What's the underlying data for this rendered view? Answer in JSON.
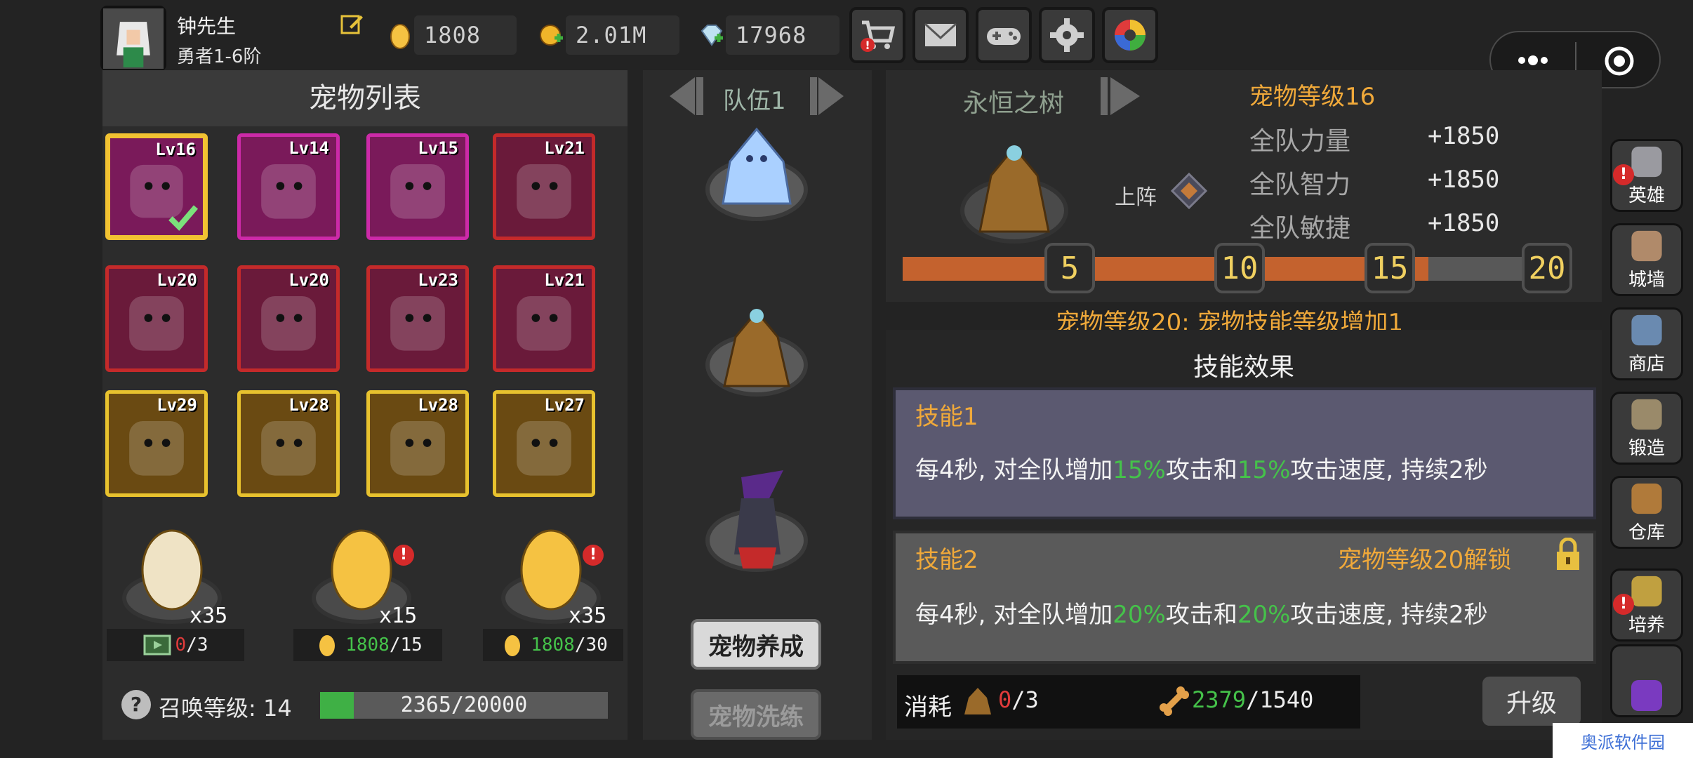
{
  "header": {
    "username": "钟先生",
    "rank": "勇者1-6阶",
    "resources": [
      {
        "icon": "egg-coin-icon",
        "value": "1808"
      },
      {
        "icon": "gold-coin-icon",
        "value": "2.01M"
      },
      {
        "icon": "diamond-icon",
        "value": "17968"
      }
    ],
    "buttons": [
      "shop-cart-icon",
      "mail-icon",
      "gamepad-icon",
      "settings-gear-icon",
      "color-wheel-icon"
    ]
  },
  "pet_list": {
    "title": "宠物列表",
    "pets": [
      {
        "level": "Lv16",
        "frame": "#f2c232",
        "bg": "#7a1a5a",
        "selected": true
      },
      {
        "level": "Lv14",
        "frame": "#cc2aa8",
        "bg": "#7a1a5a"
      },
      {
        "level": "Lv15",
        "frame": "#cc2aa8",
        "bg": "#7a1a5a"
      },
      {
        "level": "Lv21",
        "frame": "#c42a2a",
        "bg": "#6a1a3a"
      },
      {
        "level": "Lv20",
        "frame": "#c42a2a",
        "bg": "#6a1a3a"
      },
      {
        "level": "Lv20",
        "frame": "#c42a2a",
        "bg": "#6a1a3a"
      },
      {
        "level": "Lv23",
        "frame": "#c42a2a",
        "bg": "#6a1a3a"
      },
      {
        "level": "Lv21",
        "frame": "#c42a2a",
        "bg": "#6a1a3a"
      },
      {
        "level": "Lv29",
        "frame": "#e8c22e",
        "bg": "#6a4a12"
      },
      {
        "level": "Lv28",
        "frame": "#e8c22e",
        "bg": "#6a4a12"
      },
      {
        "level": "Lv28",
        "frame": "#e8c22e",
        "bg": "#6a4a12"
      },
      {
        "level": "Lv27",
        "frame": "#e8c22e",
        "bg": "#6a4a12"
      }
    ]
  },
  "eggs": [
    {
      "count": "x35",
      "cost_current": "0",
      "cost_total": "/3",
      "color": "#efe3c5"
    },
    {
      "count": "x15",
      "cost_current": "1808",
      "cost_total": "/15",
      "color": "#f5c242"
    },
    {
      "count": "x35",
      "cost_current": "1808",
      "cost_total": "/30",
      "color": "#f5c242"
    }
  ],
  "summon": {
    "label": "召唤等级: 14",
    "progress_text": "2365/20000",
    "progress": 0.118
  },
  "team": {
    "label": "队伍1",
    "train_button": "宠物养成",
    "refine_button": "宠物洗练"
  },
  "pet_detail": {
    "name": "永恒之树",
    "level_label": "宠物等级16",
    "deploy_label": "上阵",
    "stats": [
      {
        "label": "全队力量",
        "value": "+1850"
      },
      {
        "label": "全队智力",
        "value": "+1850"
      },
      {
        "label": "全队敏捷",
        "value": "+1850"
      }
    ],
    "milestones": [
      "5",
      "10",
      "15",
      "20"
    ],
    "level_progress": 0.8,
    "milestone_note": "宠物等级20: 宠物技能等级增加1"
  },
  "skills": {
    "title": "技能效果",
    "skill1": {
      "name": "技能1",
      "text_a": "每4秒, 对全队增加",
      "pct_a": "15%",
      "text_b": "攻击和",
      "pct_b": "15%",
      "text_c": "攻击速度, 持续2秒"
    },
    "skill2": {
      "name": "技能2",
      "unlock": "宠物等级20解锁",
      "text_a": "每4秒, 对全队增加",
      "pct_a": "20%",
      "text_b": "攻击和",
      "pct_b": "20%",
      "text_c": "攻击速度, 持续2秒"
    }
  },
  "cost": {
    "label": "消耗",
    "pet_current": "0",
    "pet_total": "/3",
    "bone_current": "2379",
    "bone_total": "/1540",
    "upgrade_button": "升级"
  },
  "side_nav": [
    {
      "label": "英雄",
      "icon": "helmet-icon",
      "alert": true
    },
    {
      "label": "城墙",
      "icon": "castle-wall-icon",
      "alert": false
    },
    {
      "label": "商店",
      "icon": "store-icon",
      "alert": false
    },
    {
      "label": "锻造",
      "icon": "anvil-icon",
      "alert": false
    },
    {
      "label": "仓库",
      "icon": "treasure-chest-icon",
      "alert": false
    },
    {
      "label": "培养",
      "icon": "trophy-icon",
      "alert": true
    },
    {
      "label": "",
      "icon": "portal-icon",
      "alert": false
    }
  ],
  "watermark": "奥派软件园"
}
